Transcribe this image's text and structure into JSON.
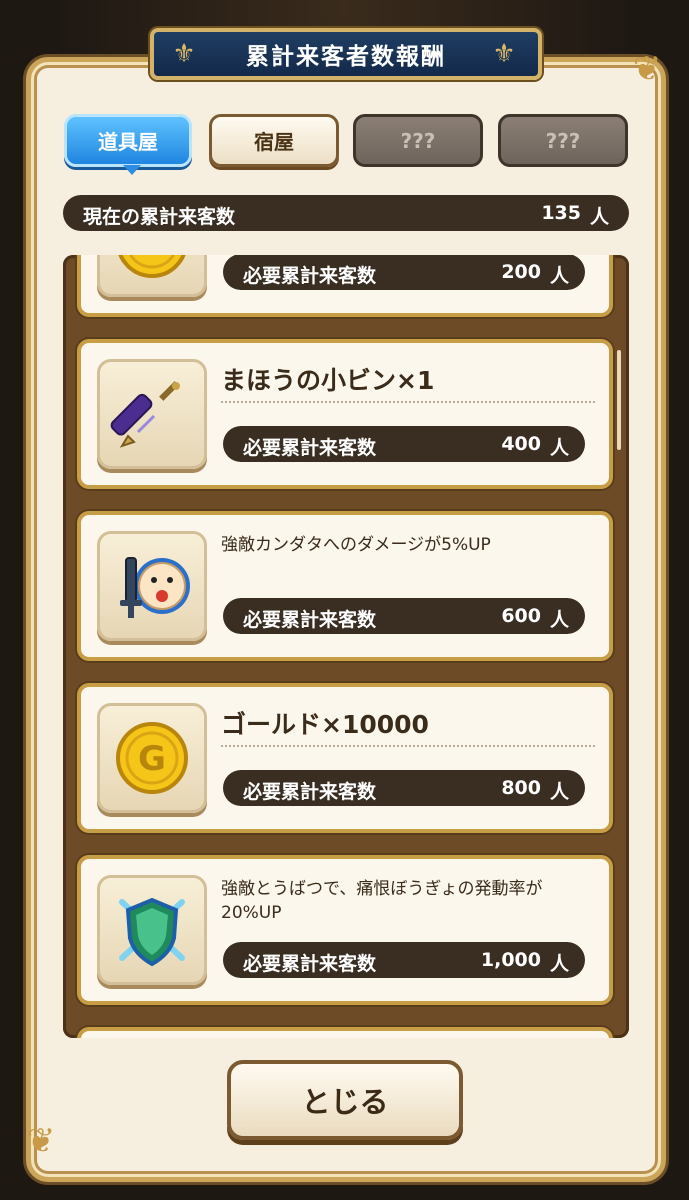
{
  "window": {
    "title": "累計来客者数報酬"
  },
  "tabs": [
    {
      "label": "道具屋",
      "state": "active"
    },
    {
      "label": "宿屋",
      "state": "normal"
    },
    {
      "label": "???",
      "state": "locked"
    },
    {
      "label": "???",
      "state": "locked"
    }
  ],
  "current": {
    "label": "現在の累計来客数",
    "value": "135",
    "unit": "人"
  },
  "rewards": [
    {
      "icon": "gold-coin-icon",
      "name": "",
      "desc": "",
      "req_label": "必要累計来客数",
      "req_value": "200",
      "unit": "人"
    },
    {
      "icon": "magic-vial-icon",
      "name": "まほうの小ビン×1",
      "desc": "",
      "req_label": "必要累計来客数",
      "req_value": "400",
      "unit": "人"
    },
    {
      "icon": "kandata-damage-icon",
      "name": "",
      "desc": "強敵カンダタへのダメージが5%UP",
      "req_label": "必要累計来客数",
      "req_value": "600",
      "unit": "人"
    },
    {
      "icon": "gold-coin-icon",
      "name": "ゴールド×10000",
      "desc": "",
      "req_label": "必要累計来客数",
      "req_value": "800",
      "unit": "人"
    },
    {
      "icon": "defense-shield-icon",
      "name": "",
      "desc": "強敵とうばつで、痛恨ぼうぎょの発動率が20%UP",
      "req_label": "必要累計来客数",
      "req_value": "1,000",
      "unit": "人"
    }
  ],
  "close": {
    "label": "とじる"
  },
  "colors": {
    "accent_blue": "#1f86e0",
    "frame_gold": "#caa55a",
    "bar_dark": "#3a2d21"
  }
}
